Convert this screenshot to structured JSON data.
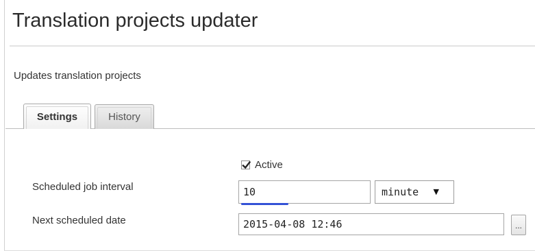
{
  "header": {
    "title": "Translation projects updater"
  },
  "description": "Updates translation projects",
  "tabs": [
    {
      "label": "Settings",
      "selected": true
    },
    {
      "label": "History",
      "selected": false
    }
  ],
  "form": {
    "active": {
      "label": "Active",
      "checked": true
    },
    "interval": {
      "label": "Scheduled job interval",
      "value": "10",
      "unit": "minute",
      "unit_options": [
        "minute"
      ]
    },
    "next_date": {
      "label": "Next scheduled date",
      "value": "2015-04-08 12:46",
      "picker_label": "..."
    }
  },
  "icons": {
    "checkbox": "checkmark-icon",
    "select_caret": "caret-down-icon"
  }
}
